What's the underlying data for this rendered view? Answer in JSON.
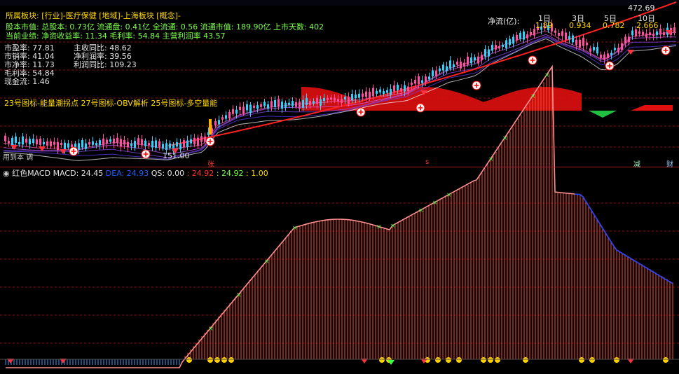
{
  "window": {
    "title_fragment": ""
  },
  "info": {
    "sector_line": "所属板块: [行业]-医疗保健 [地域]-上海板块 [概念]-",
    "capital_line": "股本市值: 总股本: 0.73亿 流通盘: 0.41亿 全流通: 0.56 流通市值: 189.90亿 上市天数: 402",
    "performance_line": "当前业绩: 净资收益率: 11.34 毛利率: 54.84 主营利润率 43.57"
  },
  "ratios_left": [
    {
      "label": "市盈率",
      "value": "77.81"
    },
    {
      "label": "市销率",
      "value": "41.04"
    },
    {
      "label": "市净率",
      "value": "11.73"
    },
    {
      "label": "毛利率",
      "value": "54.84"
    },
    {
      "label": "现金流",
      "value": "1.46"
    }
  ],
  "ratios_right": [
    {
      "label": "主收同比",
      "value": "48.62"
    },
    {
      "label": "净利润率",
      "value": "39.56"
    },
    {
      "label": "利润同比",
      "value": "109.23"
    }
  ],
  "indicator_legend": "23号图标-能量潮拐点 27号图标-OBV解析 25号图标-多空量能",
  "price_labels": {
    "high": "472.69",
    "low": "151.00",
    "net_flow_label": "净流(亿):",
    "day1": "1日",
    "day3": "3日",
    "day5": "5日",
    "day10": "10日",
    "v1": "1.89",
    "v3": "0.934",
    "v5": "0.782",
    "v10": "2.666"
  },
  "bottom_tags": {
    "left_text": "用到本 调",
    "zhang": "张",
    "s": "s",
    "jian": "减",
    "cai": "财"
  },
  "macd": {
    "title": "红色MACD",
    "macd_label": "MACD:",
    "macd_value": "24.45",
    "dea_label": "DEA:",
    "dea_value": "24.93",
    "qs_label": "QS:",
    "qs_value": "0.00",
    "extra1": ": 24.92",
    "extra2": ": 24.92",
    "extra3": ": 1.00"
  },
  "colors": {
    "bull": "#ff4fa0",
    "bear": "#30d0ff",
    "ma": "#ff2020",
    "grid": "#8a1010",
    "macd_line": "#ff9090",
    "macd_blue": "#2040ff",
    "area_red": "#e01010",
    "area_green": "#20c040"
  }
}
